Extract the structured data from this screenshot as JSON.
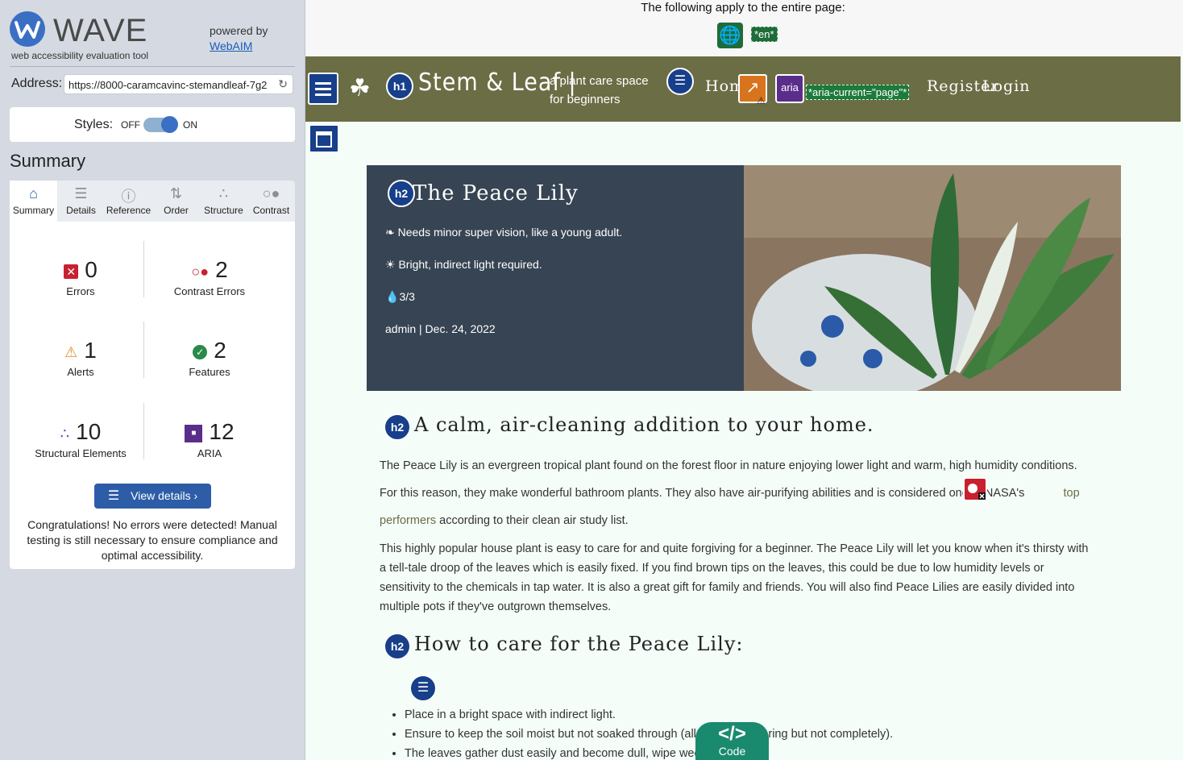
{
  "wave": {
    "brand": "WAVE",
    "tagline": "web accessibility evaluation tool",
    "powered_by": "powered by",
    "powered_link": "WebAIM",
    "address_label": "Address:",
    "address_value": "https://8000-caramcavinc-stemandleaf-7g2",
    "styles_label": "Styles:",
    "styles_off": "OFF",
    "styles_on": "ON",
    "summary_title": "Summary",
    "tabs": [
      "Summary",
      "Details",
      "Reference",
      "Order",
      "Structure",
      "Contrast"
    ],
    "stats": {
      "errors": {
        "count": "0",
        "label": "Errors"
      },
      "contrast": {
        "count": "2",
        "label": "Contrast Errors"
      },
      "alerts": {
        "count": "1",
        "label": "Alerts"
      },
      "features": {
        "count": "2",
        "label": "Features"
      },
      "structural": {
        "count": "10",
        "label": "Structural Elements"
      },
      "aria": {
        "count": "12",
        "label": "ARIA"
      }
    },
    "view_details": "View details ›",
    "congrats": "Congratulations! No errors were detected! Manual testing is still necessary to ensure compliance and optimal accessibility."
  },
  "page": {
    "apply_text": "The following apply to the entire page:",
    "lang_tag": "*en*",
    "brand": "Stem & Leaf |",
    "tagline_1": "a plant care space",
    "tagline_2": "for beginners",
    "nav_home": "Home",
    "aria_current": "*aria-current=\"page\"*",
    "nav_register": "Register",
    "nav_login": "Login",
    "hero_title": "The Peace Lily",
    "hero_care": "Needs minor super vision, like a young adult.",
    "hero_light": "Bright, indirect light required.",
    "hero_water": "3/3",
    "hero_meta": "admin | Dec. 24, 2022",
    "h2_calm": "A calm, air-cleaning addition to your home.",
    "p1_a": "The Peace Lily is an evergreen tropical plant found on the forest floor in nature enjoying lower light and warm, high humidity conditions. For this reason, they make wonderful bathroom plants. They also have air-purifying abilities and is considered one of NASA's",
    "p1_link": "top performers",
    "p1_b": "according to their clean air study list.",
    "p2": "This highly popular house plant is easy to care for and quite forgiving for a beginner. The Peace Lily will let you know when it's thirsty with a tell-tale droop of the leaves which is easily fixed. If you find brown tips on the leaves, this could be due to low humidity levels or sensitivity to the chemicals in tap water. It is also a great gift for family and friends. You will also find Peace Lilies are easily divided into multiple pots if they've outgrown themselves.",
    "h2_care": "How to care for the Peace Lily:",
    "bullets": [
      "Place in a bright space with indirect light.",
      "Ensure to keep the soil moist but not soaked through (allow ... en watering but not completely).",
      "The leaves gather dust easily and become dull, wipe weekl ... gloss."
    ],
    "code_label": "Code",
    "code_glyph": "</>"
  },
  "colors": {
    "wave_blue": "#3a6fc4",
    "nav_olive": "#6b6d45",
    "hero_slate": "#374453",
    "page_bg": "#f4fdf8",
    "code_teal": "#1a8a6e",
    "error_red": "#c8202e"
  }
}
